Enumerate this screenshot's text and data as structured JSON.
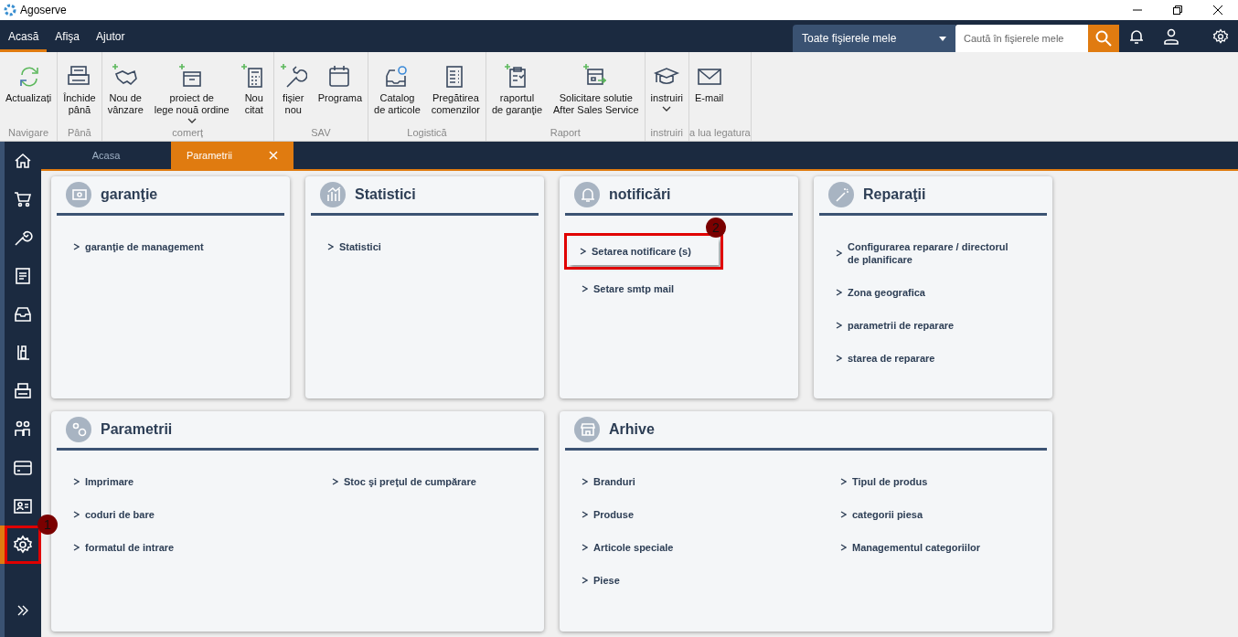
{
  "window": {
    "title": "Agoserve"
  },
  "menu_tabs": [
    {
      "label": "Acasă",
      "selected": true
    },
    {
      "label": "Afişa",
      "selected": false
    },
    {
      "label": "Ajutor",
      "selected": false
    }
  ],
  "scope_dropdown": {
    "value": "Toate fişierele mele"
  },
  "search": {
    "placeholder": "Caută în fişierele mele"
  },
  "ribbon": {
    "groups": [
      {
        "label": "Navigare",
        "items": [
          {
            "label": "Actualizați",
            "dropdown": false
          }
        ]
      },
      {
        "label": "Până",
        "items": [
          {
            "label": "Închide\npână",
            "dropdown": false
          }
        ]
      },
      {
        "label": "comerț",
        "items": [
          {
            "label": "Nou de\nvânzare",
            "dropdown": false
          },
          {
            "label": "proiect de\nlege nouă ordine",
            "dropdown": true
          },
          {
            "label": "Nou\ncitat",
            "dropdown": false
          }
        ]
      },
      {
        "label": "SAV",
        "items": [
          {
            "label": "fişier\nnou",
            "dropdown": false
          },
          {
            "label": "Programa",
            "dropdown": false
          }
        ]
      },
      {
        "label": "Logistică",
        "items": [
          {
            "label": "Catalog\nde articole",
            "dropdown": false
          },
          {
            "label": "Pregătirea\ncomenzilor",
            "dropdown": false
          }
        ]
      },
      {
        "label": "Raport",
        "items": [
          {
            "label": "raportul\nde garanţie",
            "dropdown": false
          },
          {
            "label": "Solicitare solutie\nAfter Sales Service",
            "dropdown": false
          }
        ]
      },
      {
        "label": "instruiri",
        "items": [
          {
            "label": "instruiri",
            "dropdown": true
          }
        ]
      },
      {
        "label": "a lua legatura",
        "items": [
          {
            "label": "E-mail",
            "dropdown": false
          }
        ]
      }
    ]
  },
  "sidebar": {
    "items": [
      {
        "selected": false,
        "highlighted": false
      },
      {
        "selected": false,
        "highlighted": false
      },
      {
        "selected": false,
        "highlighted": false
      },
      {
        "selected": false,
        "highlighted": false
      },
      {
        "selected": false,
        "highlighted": false
      },
      {
        "selected": false,
        "highlighted": false
      },
      {
        "selected": false,
        "highlighted": false
      },
      {
        "selected": false,
        "highlighted": false
      },
      {
        "selected": false,
        "highlighted": false
      },
      {
        "selected": false,
        "highlighted": false
      },
      {
        "selected": true,
        "highlighted": true,
        "callout": "1"
      }
    ]
  },
  "tabs": [
    {
      "label": "Acasa",
      "selected": false,
      "closable": false
    },
    {
      "label": "Parametrii",
      "selected": true,
      "closable": true
    }
  ],
  "cards": [
    {
      "title": "garanţie",
      "columns": [
        [
          {
            "label": "garanţie de management",
            "highlighted": false
          }
        ]
      ]
    },
    {
      "title": "Statistici",
      "columns": [
        [
          {
            "label": "Statistici",
            "highlighted": false
          }
        ]
      ]
    },
    {
      "title": "notificări",
      "columns": [
        [
          {
            "label": "Setarea notificare (s)",
            "highlighted": true,
            "callout": "2"
          },
          {
            "label": "Setare smtp mail",
            "highlighted": false
          }
        ]
      ]
    },
    {
      "title": "Reparaţii",
      "columns": [
        [
          {
            "label": "Configurarea reparare / directorul\nde planificare",
            "highlighted": false
          },
          {
            "label": "Zona geografica",
            "highlighted": false
          },
          {
            "label": "parametrii de reparare",
            "highlighted": false
          },
          {
            "label": "starea de reparare",
            "highlighted": false
          }
        ]
      ]
    },
    {
      "title": "Parametrii",
      "columns": [
        [
          {
            "label": "Imprimare",
            "highlighted": false
          },
          {
            "label": "coduri de bare",
            "highlighted": false
          },
          {
            "label": "formatul de intrare",
            "highlighted": false
          }
        ],
        [
          {
            "label": "Stoc şi preţul de cumpărare",
            "highlighted": false
          }
        ]
      ]
    },
    {
      "title": "Arhive",
      "columns": [
        [
          {
            "label": "Branduri",
            "highlighted": false
          },
          {
            "label": "Produse",
            "highlighted": false
          },
          {
            "label": "Articole speciale",
            "highlighted": false
          },
          {
            "label": "Piese",
            "highlighted": false
          }
        ],
        [
          {
            "label": "Tipul de produs",
            "highlighted": false
          },
          {
            "label": "categorii piesa",
            "highlighted": false
          },
          {
            "label": "Managementul categoriilor",
            "highlighted": false
          }
        ]
      ]
    }
  ]
}
